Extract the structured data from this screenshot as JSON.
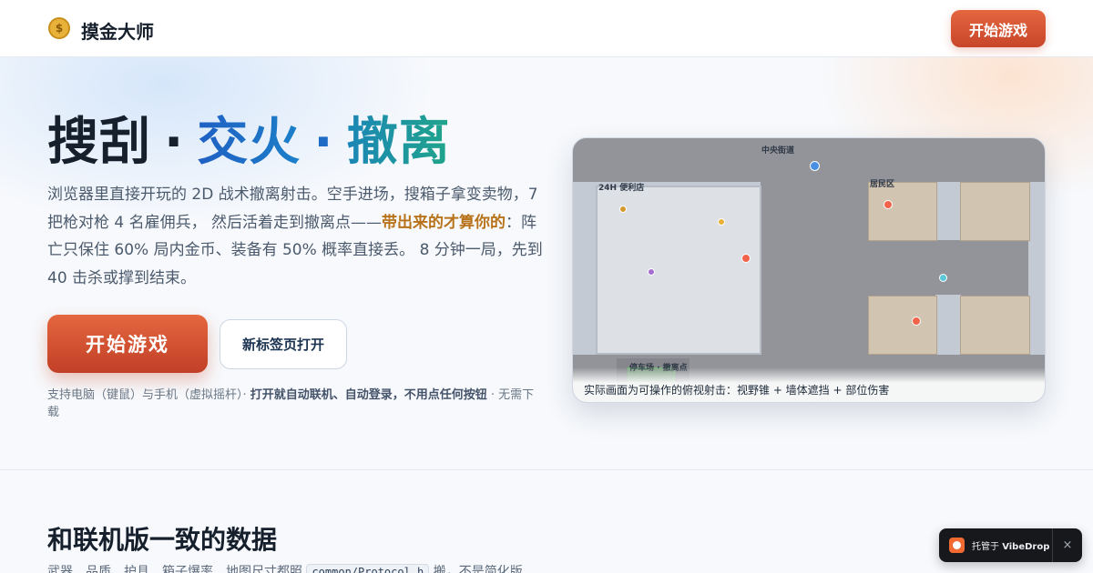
{
  "header": {
    "logo_glyph": "$",
    "app_name": "摸金大师",
    "start_button": "开始游戏"
  },
  "hero": {
    "title": {
      "part1": "搜刮",
      "sep1": "·",
      "part2": "交火",
      "sep2": "·",
      "part3": "撤离"
    },
    "desc_before": "浏览器里直接开玩的 2D 战术撤离射击。空手进场，搜箱子拿变卖物，7 把枪对枪 4 名雇佣兵， 然后活着走到撤离点——",
    "desc_highlight": "带出来的才算你的",
    "desc_after": "：阵亡只保住 60% 局内金币、装备有 50% 概率直接丢。 8 分钟一局，先到 40 击杀或撑到结束。",
    "primary_button": "开始游戏",
    "secondary_button": "新标签页打开",
    "note_before": "支持电脑（键鼠）与手机（虚拟摇杆）· ",
    "note_bold": "打开就自动联机、自动登录，不用点任何按钮",
    "note_after": " · 无需下载"
  },
  "preview": {
    "labels": {
      "main_street": "中央街道",
      "store": "24H 便利店",
      "residential": "居民区",
      "parking": "停车场 · 撤离点"
    },
    "caption": "实际画面为可操作的俯视射击：视野锥 + 墙体遮挡 + 部位伤害",
    "colors": {
      "player": "#4a90e2",
      "enemy": "#f2644a",
      "loot_gold": "#e8b23a",
      "loot_purple": "#a66cd0",
      "teammate": "#5bc8d8"
    }
  },
  "section": {
    "title": "和联机版一致的数据",
    "sub_before": "武器、品质、护具、箱子爆率、地图尺寸都照 ",
    "sub_code": "common/Protocol.h",
    "sub_after": " 搬，不是简化版"
  },
  "badge": {
    "text_before": "托管于 ",
    "text_bold": "VibeDrop",
    "close": "×"
  }
}
